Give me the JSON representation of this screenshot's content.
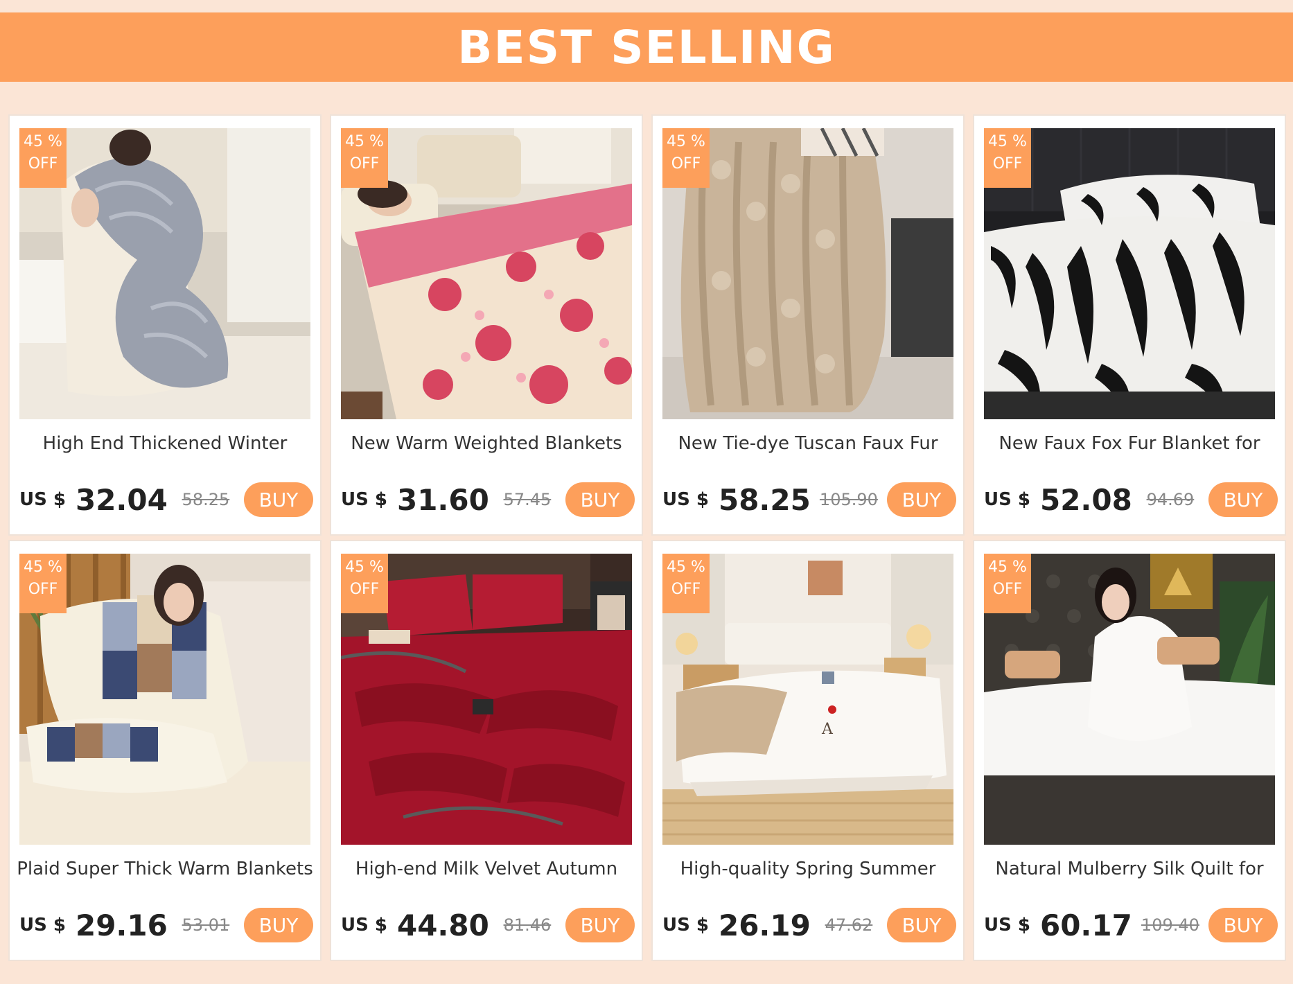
{
  "banner": {
    "title": "BEST SELLING",
    "color": "#fd9f5b"
  },
  "badge": {
    "line1": "45 %",
    "line2": "OFF"
  },
  "products": [
    {
      "title": "High End Thickened Winter",
      "currency": "US $",
      "price": "32.04",
      "old_price": "58.25",
      "buy_label": "BUY",
      "image": "person-hugging-grey-knit-duvet"
    },
    {
      "title": "New Warm Weighted Blankets",
      "currency": "US $",
      "price": "31.60",
      "old_price": "57.45",
      "buy_label": "BUY",
      "image": "woman-in-bed-pink-rose-blanket"
    },
    {
      "title": "New Tie-dye Tuscan Faux Fur",
      "currency": "US $",
      "price": "58.25",
      "old_price": "105.90",
      "buy_label": "BUY",
      "image": "beige-faux-fur-throw"
    },
    {
      "title": "New Faux Fox Fur Blanket for",
      "currency": "US $",
      "price": "52.08",
      "old_price": "94.69",
      "buy_label": "BUY",
      "image": "zebra-print-fur-bedding"
    },
    {
      "title": "Plaid Super Thick Warm Blankets",
      "currency": "US $",
      "price": "29.16",
      "old_price": "53.01",
      "buy_label": "BUY",
      "image": "woman-hugging-plaid-comforter"
    },
    {
      "title": "High-end Milk Velvet Autumn",
      "currency": "US $",
      "price": "44.80",
      "old_price": "81.46",
      "buy_label": "BUY",
      "image": "red-velvet-bedding-set"
    },
    {
      "title": "High-quality Spring Summer",
      "currency": "US $",
      "price": "26.19",
      "old_price": "47.62",
      "buy_label": "BUY",
      "image": "white-quilt-bedroom"
    },
    {
      "title": "Natural Mulberry Silk Quilt for",
      "currency": "US $",
      "price": "60.17",
      "old_price": "109.40",
      "buy_label": "BUY",
      "image": "woman-with-white-silk-quilt"
    }
  ]
}
